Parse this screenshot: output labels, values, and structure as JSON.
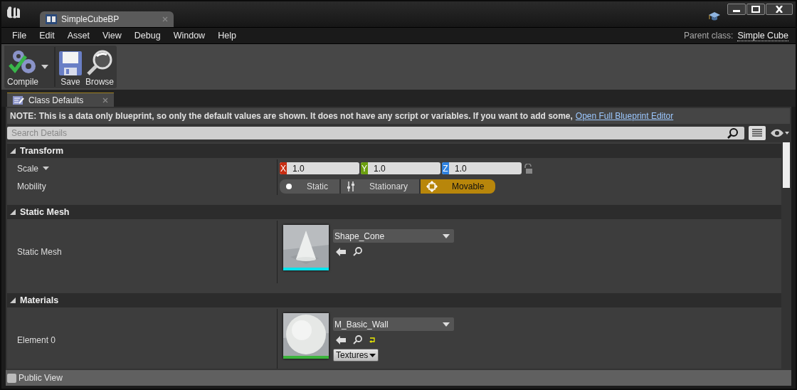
{
  "window": {
    "tab_title": "SimpleCubeBP"
  },
  "menu": [
    "File",
    "Edit",
    "Asset",
    "View",
    "Debug",
    "Window",
    "Help"
  ],
  "parent_class": {
    "label": "Parent class:",
    "value": "Simple Cube"
  },
  "toolbar": [
    {
      "kind": "compile",
      "label": "Compile"
    },
    {
      "kind": "save",
      "label": "Save"
    },
    {
      "kind": "browse",
      "label": "Browse"
    }
  ],
  "panel_tab": {
    "label": "Class Defaults"
  },
  "note": {
    "text": "NOTE: This is a data only blueprint, so only the default values are shown.  It does not have any script or variables.  If you want to add some,",
    "link": "Open Full Blueprint Editor"
  },
  "search": {
    "placeholder": "Search Details"
  },
  "sections": [
    {
      "title": "Transform",
      "expanded": true,
      "rows": [
        {
          "kind": "vector",
          "label": "Scale",
          "axes": [
            {
              "axis": "X",
              "value": "1.0",
              "color": "#c62d12"
            },
            {
              "axis": "Y",
              "value": "1.0",
              "color": "#6b9e0f"
            },
            {
              "axis": "Z",
              "value": "1.0",
              "color": "#2f82e0"
            }
          ],
          "locked": false
        },
        {
          "kind": "mobility",
          "label": "Mobility",
          "options": [
            {
              "kind": "static",
              "label": "Static",
              "selected": false
            },
            {
              "kind": "stationary",
              "label": "Stationary",
              "selected": false
            },
            {
              "kind": "movable",
              "label": "Movable",
              "selected": true
            }
          ]
        }
      ]
    },
    {
      "title": "Static Mesh",
      "expanded": true,
      "rows": [
        {
          "kind": "asset",
          "label": "Static Mesh",
          "asset": "Shape_Cone",
          "thumbnail": {
            "kind": "mesh"
          },
          "color": "#00e5ee",
          "reset_to_default": false
        }
      ]
    },
    {
      "title": "Materials",
      "expanded": true,
      "rows": [
        {
          "kind": "asset",
          "label": "Element 0",
          "asset": "M_Basic_Wall",
          "thumbnail": {
            "kind": "material"
          },
          "color": "#3cb53c",
          "reset_to_default": true,
          "button": "Textures"
        }
      ]
    }
  ],
  "footer": {
    "label": "Public View",
    "checked": false
  }
}
